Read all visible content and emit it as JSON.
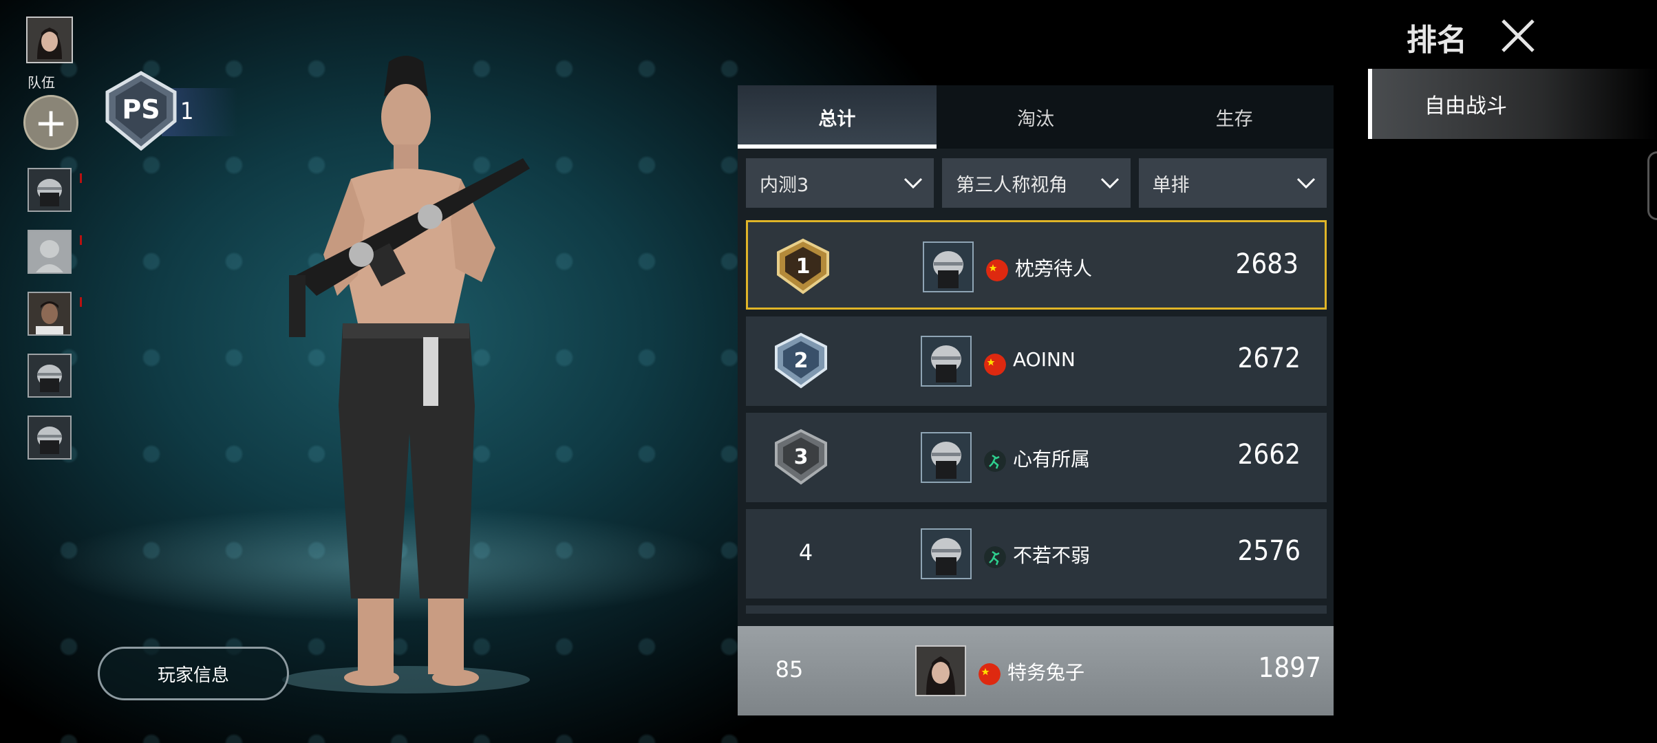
{
  "left_sidebar": {
    "team_label": "队伍",
    "add_icon": "plus-icon"
  },
  "rank_badge": {
    "tier_text": "PS",
    "level": "1"
  },
  "player_info_button": "玩家信息",
  "header": {
    "title": "排名",
    "close_icon": "close-icon"
  },
  "mode_list": {
    "items": [
      "自由战斗"
    ]
  },
  "tabs": [
    {
      "label": "总计",
      "active": true
    },
    {
      "label": "淘汰",
      "active": false
    },
    {
      "label": "生存",
      "active": false
    }
  ],
  "filters": [
    {
      "value": "内测3"
    },
    {
      "value": "第三人称视角"
    },
    {
      "value": "单排"
    }
  ],
  "leaderboard": [
    {
      "rank": "1",
      "name": "枕旁待人",
      "score": "2683",
      "flag": "china-flag"
    },
    {
      "rank": "2",
      "name": "AOINN",
      "score": "2672",
      "flag": "china-flag"
    },
    {
      "rank": "3",
      "name": "心有所属",
      "score": "2662",
      "flag": "green-runner-flag"
    },
    {
      "rank": "4",
      "name": "不若不弱",
      "score": "2576",
      "flag": "green-runner-flag"
    }
  ],
  "my_entry": {
    "rank": "85",
    "name": "特务兔子",
    "score": "1897",
    "flag": "china-flag"
  },
  "colors": {
    "gold_highlight": "#e0b528",
    "row_bg": "#2b343c",
    "my_row_bg": "#8e9498"
  }
}
